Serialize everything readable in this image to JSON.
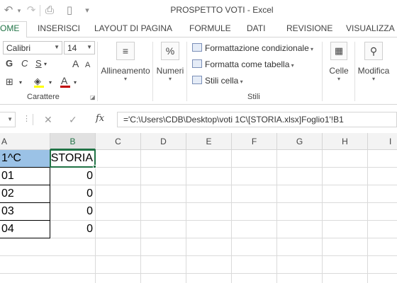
{
  "window": {
    "title": "PROSPETTO VOTI - Excel"
  },
  "quick_access": [
    {
      "name": "undo-icon",
      "glyph": "↶"
    },
    {
      "name": "redo-icon",
      "glyph": "↷"
    },
    {
      "name": "print-preview-icon",
      "glyph": "⎙"
    },
    {
      "name": "new-document-icon",
      "glyph": "▯"
    },
    {
      "name": "customize-dropdown-icon",
      "glyph": "▾"
    }
  ],
  "tabs": {
    "home": "OME",
    "insert": "INSERISCI",
    "page_layout": "LAYOUT DI PAGINA",
    "formulas": "FORMULE",
    "data": "DATI",
    "review": "REVISIONE",
    "view": "VISUALIZZA"
  },
  "ribbon": {
    "font": {
      "family": "Calibri",
      "size": "14",
      "bold_label": "G",
      "italic_label": "C",
      "underline_label": "S",
      "grow_label": "A",
      "shrink_label": "A",
      "font_color_label": "A",
      "group_label": "Carattere"
    },
    "alignment": {
      "label": "Allineamento"
    },
    "number": {
      "label": "Numeri",
      "icon": "%"
    },
    "styles": {
      "conditional": "Formattazione condizionale",
      "table": "Formatta come tabella",
      "cell_styles": "Stili cella",
      "group_label": "Stili"
    },
    "cells": {
      "label": "Celle"
    },
    "editing": {
      "label": "Modifica"
    }
  },
  "formula_bar": {
    "fx": "fx",
    "content": "='C:\\Users\\CDB\\Desktop\\voti 1C\\[STORIA.xlsx]Foglio1'!B1"
  },
  "colors": {
    "accent": "#217346",
    "header_fill": "#9bc2e6"
  },
  "sheet": {
    "columns": [
      "A",
      "B",
      "C",
      "D",
      "E",
      "F",
      "G",
      "H",
      "I"
    ],
    "active_column": "B",
    "rows": [
      {
        "a": "1^C",
        "b": "STORIA"
      },
      {
        "a": "01",
        "b": "0"
      },
      {
        "a": "02",
        "b": "0"
      },
      {
        "a": "03",
        "b": "0"
      },
      {
        "a": "04",
        "b": "0"
      },
      {
        "a": "",
        "b": ""
      },
      {
        "a": "",
        "b": ""
      }
    ]
  }
}
